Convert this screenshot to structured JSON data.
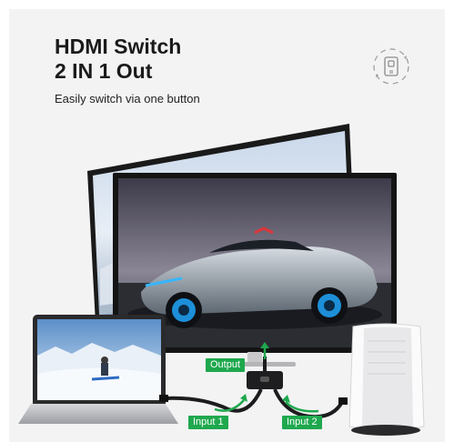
{
  "header": {
    "title_line1": "HDMI Switch",
    "title_line2": "2 IN 1 Out",
    "subtitle": "Easily switch via one button"
  },
  "icons": {
    "top_right": "one-button-switch-icon"
  },
  "labels": {
    "output": "Output",
    "input1": "Input 1",
    "input2": "Input 2"
  },
  "colors": {
    "accent": "#1fa84e",
    "title": "#1a1a1a",
    "background": "#f3f3f4"
  }
}
